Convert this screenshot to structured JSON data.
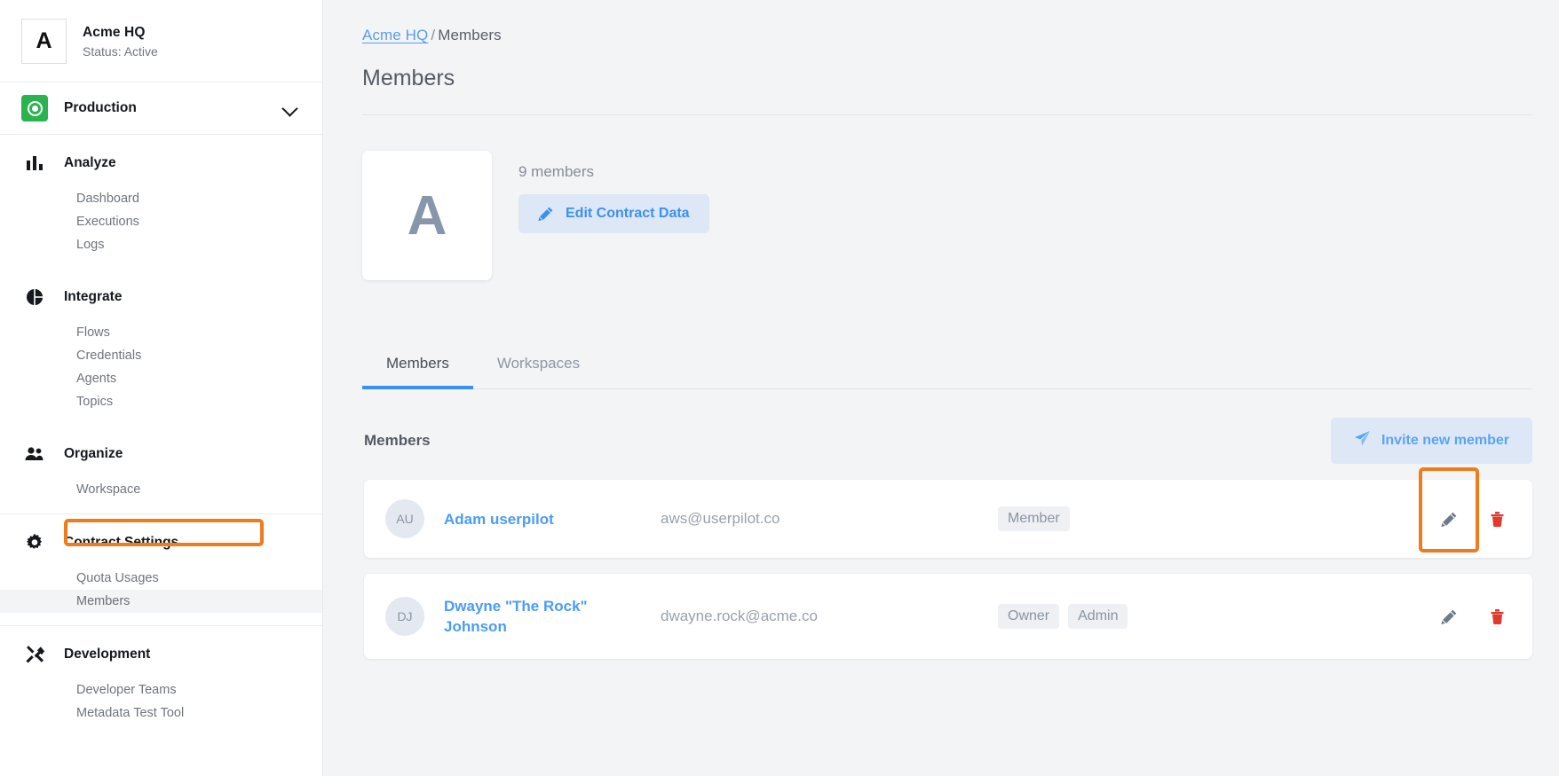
{
  "sidebar": {
    "org": {
      "logo_letter": "A",
      "name": "Acme HQ",
      "status": "Status: Active"
    },
    "environment": {
      "label": "Production",
      "chevron_icon": "chevron-down-icon"
    },
    "groups": [
      {
        "label": "Analyze",
        "icon": "bar-chart-icon",
        "items": [
          {
            "label": "Dashboard",
            "active": false
          },
          {
            "label": "Executions",
            "active": false
          },
          {
            "label": "Logs",
            "active": false
          }
        ]
      },
      {
        "label": "Integrate",
        "icon": "pie-chart-icon",
        "items": [
          {
            "label": "Flows",
            "active": false
          },
          {
            "label": "Credentials",
            "active": false
          },
          {
            "label": "Agents",
            "active": false
          },
          {
            "label": "Topics",
            "active": false
          }
        ]
      },
      {
        "label": "Organize",
        "icon": "people-icon",
        "items": [
          {
            "label": "Workspace",
            "active": false
          }
        ]
      },
      {
        "label": "Contract Settings",
        "icon": "gear-icon",
        "items": [
          {
            "label": "Quota Usages",
            "active": false
          },
          {
            "label": "Members",
            "active": true
          }
        ]
      },
      {
        "label": "Development",
        "icon": "tools-icon",
        "items": [
          {
            "label": "Developer Teams",
            "active": false
          },
          {
            "label": "Metadata Test Tool",
            "active": false
          }
        ]
      }
    ]
  },
  "main": {
    "breadcrumb": {
      "root": "Acme HQ",
      "separator": "/",
      "current": "Members"
    },
    "page_title": "Members",
    "contract": {
      "avatar_letter": "A",
      "member_count": "9 members",
      "edit_button": "Edit Contract Data",
      "edit_icon": "pencil-icon"
    },
    "tabs": [
      {
        "label": "Members",
        "active": true
      },
      {
        "label": "Workspaces",
        "active": false
      }
    ],
    "list": {
      "title": "Members",
      "invite_button": "Invite new member",
      "invite_icon": "send-icon",
      "rows": [
        {
          "initials": "AU",
          "name": "Adam userpilot",
          "email": "aws@userpilot.co",
          "badges": [
            "Member"
          ],
          "edit_icon": "pencil-icon",
          "delete_icon": "trash-icon",
          "highlighted": true
        },
        {
          "initials": "DJ",
          "name": "Dwayne \"The Rock\" Johnson",
          "email": "dwayne.rock@acme.co",
          "badges": [
            "Owner",
            "Admin"
          ],
          "edit_icon": "pencil-icon",
          "delete_icon": "trash-icon",
          "highlighted": false
        }
      ]
    }
  },
  "colors": {
    "accent_blue": "#3b91f0",
    "link_blue": "#4a9cf6",
    "highlight_orange": "#f07b1d",
    "env_green": "#2bb350",
    "delete_red": "#e0392f"
  }
}
